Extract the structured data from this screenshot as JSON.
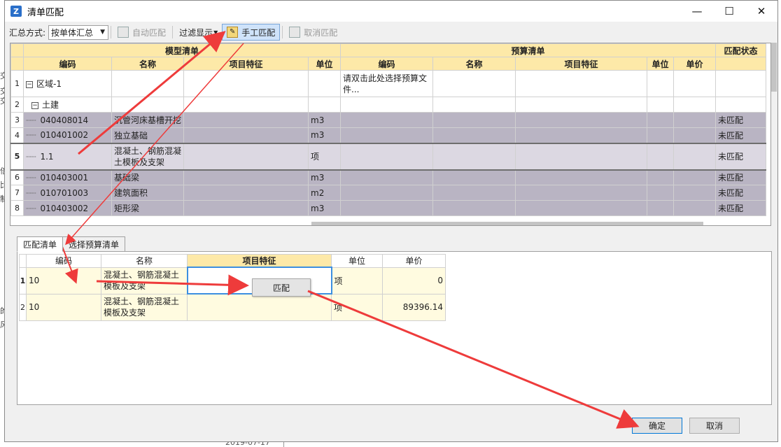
{
  "background": {
    "date_text": "2019-07-17",
    "left_chars": [
      "交",
      "交",
      "交",
      "倍",
      "比",
      "制",
      "的",
      "风"
    ]
  },
  "window": {
    "title": "清单匹配",
    "app_icon_letter": "Z",
    "minimize_glyph": "—",
    "maximize_glyph": "☐",
    "close_glyph": "✕"
  },
  "toolbar": {
    "summary_label": "汇总方式:",
    "summary_value": "按单体汇总",
    "auto_match": "自动匹配",
    "filter_display": "过滤显示",
    "manual_match": "手工匹配",
    "cancel_match": "取消匹配"
  },
  "top_grid": {
    "group_model": "模型清单",
    "group_budget": "预算清单",
    "group_status": "匹配状态",
    "columns": {
      "code": "编码",
      "name": "名称",
      "feature": "项目特征",
      "unit": "单位",
      "b_code": "编码",
      "b_name": "名称",
      "b_feature": "项目特征",
      "b_unit": "单位",
      "b_price": "单价"
    },
    "rows": [
      {
        "n": "1",
        "code": "区域-1",
        "name": "",
        "unit": "",
        "budget": "请双击此处选择预算文件...",
        "status": ""
      },
      {
        "n": "2",
        "code": "土建",
        "name": "",
        "unit": "",
        "budget": "",
        "status": ""
      },
      {
        "n": "3",
        "code": "040408014",
        "name": "沉管河床基槽开挖",
        "unit": "m3",
        "budget": "",
        "status": "未匹配"
      },
      {
        "n": "4",
        "code": "010401002",
        "name": "独立基础",
        "unit": "m3",
        "budget": "",
        "status": "未匹配"
      },
      {
        "n": "5",
        "code": "1.1",
        "name": "混凝土、钢筋混凝土模板及支架",
        "unit": "项",
        "budget": "",
        "status": "未匹配"
      },
      {
        "n": "6",
        "code": "010403001",
        "name": "基础梁",
        "unit": "m3",
        "budget": "",
        "status": "未匹配"
      },
      {
        "n": "7",
        "code": "010701003",
        "name": "建筑面积",
        "unit": "m2",
        "budget": "",
        "status": "未匹配"
      },
      {
        "n": "8",
        "code": "010403002",
        "name": "矩形梁",
        "unit": "m3",
        "budget": "",
        "status": "未匹配"
      }
    ]
  },
  "tabs": {
    "match_list": "匹配清单",
    "select_budget": "选择预算清单"
  },
  "bottom_grid": {
    "columns": {
      "code": "编码",
      "name": "名称",
      "feature": "项目特征",
      "unit": "单位",
      "price": "单价"
    },
    "rows": [
      {
        "n": "1",
        "code": "10",
        "name": "混凝土、钢筋混凝土模板及支架",
        "feature": "",
        "unit": "项",
        "price": "0"
      },
      {
        "n": "2",
        "code": "10",
        "name": "混凝土、钢筋混凝土模板及支架",
        "feature": "",
        "unit": "项",
        "price": "89396.14"
      }
    ]
  },
  "context_button": "匹配",
  "buttons": {
    "ok": "确定",
    "cancel": "取消"
  },
  "colors": {
    "header": "#fde9a8",
    "row_gray": "#b9b4c3",
    "annotation_arrow": "#ee3b3b"
  }
}
